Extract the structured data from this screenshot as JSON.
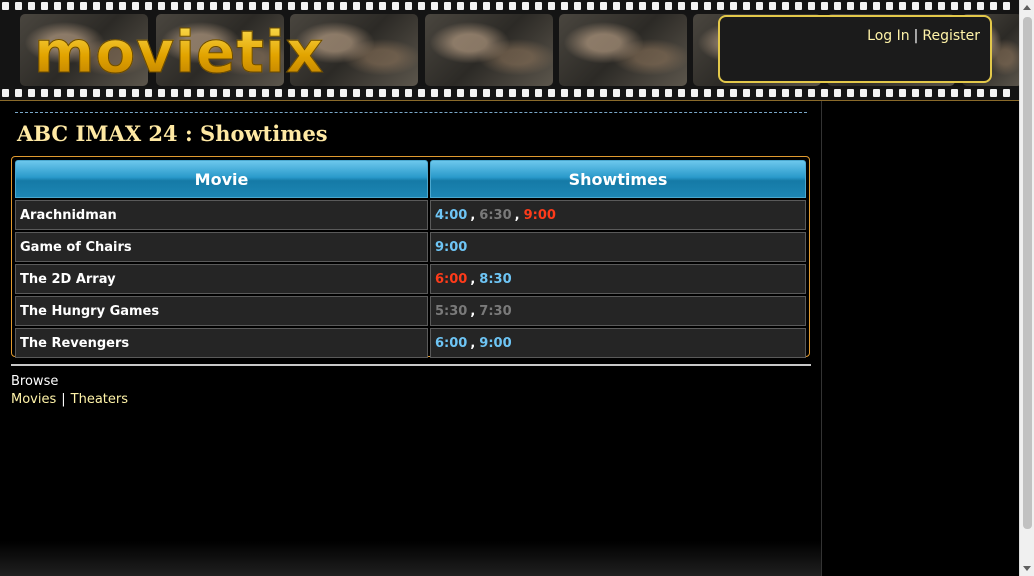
{
  "header": {
    "logo": "movietix",
    "login_label": "Log In",
    "separator": "|",
    "register_label": "Register"
  },
  "page": {
    "title": "ABC IMAX 24 : Showtimes"
  },
  "table": {
    "columns": [
      "Movie",
      "Showtimes"
    ],
    "rows": [
      {
        "movie": "Arachnidman",
        "times": [
          {
            "time": "4:00",
            "status": "available",
            "color": "#6ec5f5"
          },
          {
            "time": "6:30",
            "status": "past",
            "color": "#7a7a7a"
          },
          {
            "time": "9:00",
            "status": "sold-out",
            "color": "#ff3b1a"
          }
        ]
      },
      {
        "movie": "Game of Chairs",
        "times": [
          {
            "time": "9:00",
            "status": "available",
            "color": "#6ec5f5"
          }
        ]
      },
      {
        "movie": "The 2D Array",
        "times": [
          {
            "time": "6:00",
            "status": "sold-out",
            "color": "#ff3b1a"
          },
          {
            "time": "8:30",
            "status": "available",
            "color": "#6ec5f5"
          }
        ]
      },
      {
        "movie": "The Hungry Games",
        "times": [
          {
            "time": "5:30",
            "status": "past",
            "color": "#7a7a7a"
          },
          {
            "time": "7:30",
            "status": "past",
            "color": "#7a7a7a"
          }
        ]
      },
      {
        "movie": "The Revengers",
        "times": [
          {
            "time": "6:00",
            "status": "available",
            "color": "#6ec5f5"
          },
          {
            "time": "9:00",
            "status": "available",
            "color": "#6ec5f5"
          }
        ]
      }
    ]
  },
  "browse": {
    "label": "Browse",
    "movies_label": "Movies",
    "separator": "|",
    "theaters_label": "Theaters"
  },
  "colors": {
    "accent": "#e3c84a",
    "link": "#fff3a8",
    "title": "#ffe9a3",
    "table_border": "#e09a30"
  }
}
